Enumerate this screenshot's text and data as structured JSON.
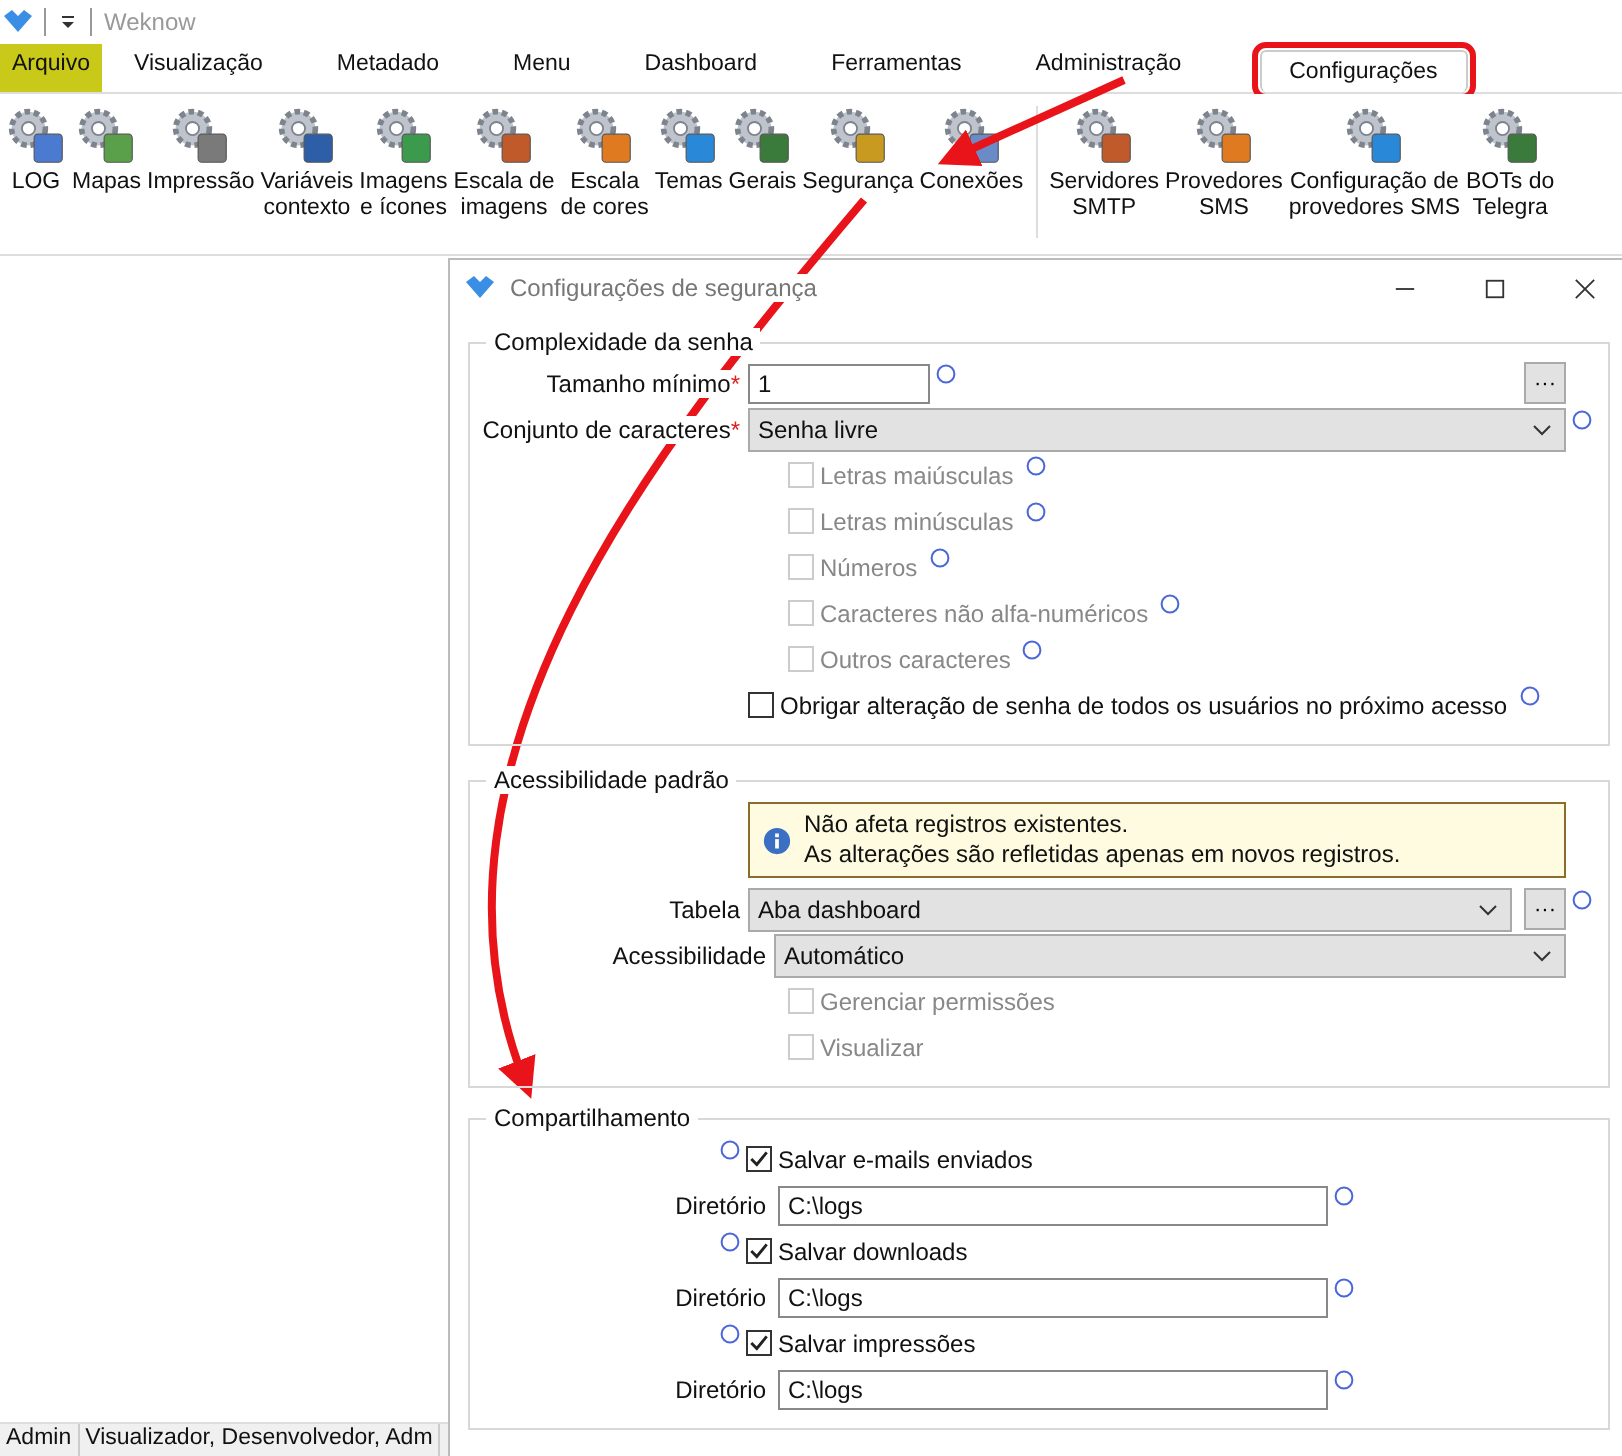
{
  "app": {
    "title": "Weknow"
  },
  "tabs": [
    {
      "label": "Arquivo",
      "kind": "file",
      "selected": false,
      "highlighted": false
    },
    {
      "label": "Visualização",
      "kind": "tab",
      "selected": false,
      "highlighted": false
    },
    {
      "label": "Metadado",
      "kind": "tab",
      "selected": false,
      "highlighted": false
    },
    {
      "label": "Menu",
      "kind": "tab",
      "selected": false,
      "highlighted": false
    },
    {
      "label": "Dashboard",
      "kind": "tab",
      "selected": false,
      "highlighted": false
    },
    {
      "label": "Ferramentas",
      "kind": "tab",
      "selected": false,
      "highlighted": false
    },
    {
      "label": "Administração",
      "kind": "tab",
      "selected": false,
      "highlighted": false
    },
    {
      "label": "Configurações",
      "kind": "tab",
      "selected": true,
      "highlighted": true
    }
  ],
  "ribbon": [
    [
      {
        "label": "LOG"
      },
      {
        "label": "Mapas"
      },
      {
        "label": "Impressão"
      },
      {
        "label": "Variáveis\ncontexto"
      },
      {
        "label": "Imagens\ne ícones"
      },
      {
        "label": "Escala de\nimagens"
      },
      {
        "label": "Escala\nde cores"
      },
      {
        "label": "Temas"
      },
      {
        "label": "Gerais"
      },
      {
        "label": "Segurança"
      },
      {
        "label": "Conexões"
      }
    ],
    [
      {
        "label": "Servidores\nSMTP"
      },
      {
        "label": "Provedores\nSMS"
      },
      {
        "label": "Configuração de\nprovedores SMS"
      },
      {
        "label": "BOTs do\nTelegra"
      }
    ]
  ],
  "status_bar": [
    "Admin",
    "Visualizador, Desenvolvedor, Adm"
  ],
  "dialog": {
    "title": "Configurações de segurança",
    "password": {
      "title": "Complexidade da senha",
      "min_length": {
        "label": "Tamanho mínimo",
        "required_mark": "*",
        "value": "1",
        "more_button": "···"
      },
      "charset": {
        "label": "Conjunto de caracteres",
        "required_mark": "*",
        "value": "Senha livre"
      },
      "options": [
        {
          "label": "Letras maiúsculas",
          "checked": false,
          "disabled": true
        },
        {
          "label": "Letras minúsculas",
          "checked": false,
          "disabled": true
        },
        {
          "label": "Números",
          "checked": false,
          "disabled": true
        },
        {
          "label": "Caracteres não alfa-numéricos",
          "checked": false,
          "disabled": true
        },
        {
          "label": "Outros caracteres",
          "checked": false,
          "disabled": true
        }
      ],
      "force_change": {
        "label": "Obrigar alteração de senha de todos os usuários no próximo acesso",
        "checked": false,
        "disabled": false
      }
    },
    "access": {
      "title": "Acessibilidade padrão",
      "info": [
        "Não afeta registros existentes.",
        "As alterações são refletidas apenas em novos registros."
      ],
      "table": {
        "label": "Tabela",
        "value": "Aba dashboard",
        "more_button": "···"
      },
      "access": {
        "label": "Acessibilidade",
        "value": "Automático"
      },
      "options": [
        {
          "label": "Gerenciar permissões",
          "checked": false,
          "disabled": true
        },
        {
          "label": "Visualizar",
          "checked": false,
          "disabled": true
        }
      ]
    },
    "sharing": {
      "title": "Compartilhamento",
      "items": [
        {
          "label": "Salvar e-mails enviados",
          "checked": true,
          "dir_label": "Diretório",
          "dir": "C:\\logs"
        },
        {
          "label": "Salvar downloads",
          "checked": true,
          "dir_label": "Diretório",
          "dir": "C:\\logs"
        },
        {
          "label": "Salvar impressões",
          "checked": true,
          "dir_label": "Diretório",
          "dir": "C:\\logs"
        }
      ]
    }
  }
}
